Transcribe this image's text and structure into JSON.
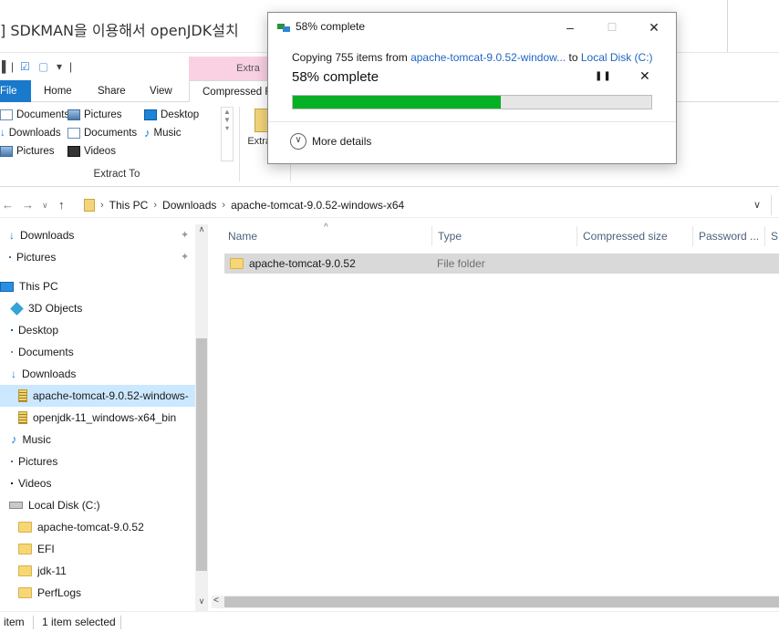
{
  "background_page": {
    "post_title": "] SDKMAN을 이용해서 openJDK설치"
  },
  "explorer": {
    "qat_glyphs": [
      "|",
      "☑",
      "▢",
      "▾",
      "|"
    ],
    "context_tab_header": "Extra",
    "tabs": [
      {
        "label": "File"
      },
      {
        "label": "Home"
      },
      {
        "label": "Share"
      },
      {
        "label": "View"
      },
      {
        "label": "Compressed F"
      }
    ],
    "ribbon": {
      "col1": [
        "Documents",
        "Downloads",
        "Pictures"
      ],
      "col2": [
        "Pictures",
        "Documents",
        "Videos"
      ],
      "col3": [
        "Desktop",
        "Music"
      ],
      "extract_to_label": "Extract To",
      "extract_all_label": "Extra al"
    },
    "address": {
      "crumbs": [
        "This PC",
        "Downloads",
        "apache-tomcat-9.0.52-windows-x64"
      ]
    },
    "nav_pane": [
      {
        "label": "Downloads",
        "icon": "download-icon",
        "pinned": true
      },
      {
        "label": "Pictures",
        "icon": "pictures-icon",
        "pinned": true
      },
      {
        "label": "This PC",
        "icon": "pc-icon"
      },
      {
        "label": "3D Objects",
        "icon": "3d-objects-icon"
      },
      {
        "label": "Desktop",
        "icon": "desktop-icon"
      },
      {
        "label": "Documents",
        "icon": "documents-icon"
      },
      {
        "label": "Downloads",
        "icon": "download-icon"
      },
      {
        "label": "apache-tomcat-9.0.52-windows-",
        "icon": "zip-folder-icon",
        "selected": true
      },
      {
        "label": "openjdk-11_windows-x64_bin",
        "icon": "zip-folder-icon"
      },
      {
        "label": "Music",
        "icon": "music-icon"
      },
      {
        "label": "Pictures",
        "icon": "pictures-icon"
      },
      {
        "label": "Videos",
        "icon": "videos-icon"
      },
      {
        "label": "Local Disk (C:)",
        "icon": "drive-icon"
      },
      {
        "label": "apache-tomcat-9.0.52",
        "icon": "folder-icon"
      },
      {
        "label": "EFI",
        "icon": "folder-icon"
      },
      {
        "label": "jdk-11",
        "icon": "folder-icon"
      },
      {
        "label": "PerfLogs",
        "icon": "folder-icon"
      }
    ],
    "columns": [
      "Name",
      "Type",
      "Compressed size",
      "Password ...",
      "S"
    ],
    "rows": [
      {
        "name": "apache-tomcat-9.0.52",
        "type": "File folder"
      }
    ],
    "status": {
      "count": "item",
      "selected": "1 item selected"
    }
  },
  "dialog": {
    "title": "58% complete",
    "copying_prefix": "Copying 755 items from ",
    "source": "apache-tomcat-9.0.52-window...",
    "to_word": " to ",
    "destination": "Local Disk (C:)",
    "percent_text": "58% complete",
    "progress": 0.58,
    "more_details": "More details",
    "colors": {
      "progress_fill": "#06b025",
      "link": "#1f66c0"
    }
  }
}
